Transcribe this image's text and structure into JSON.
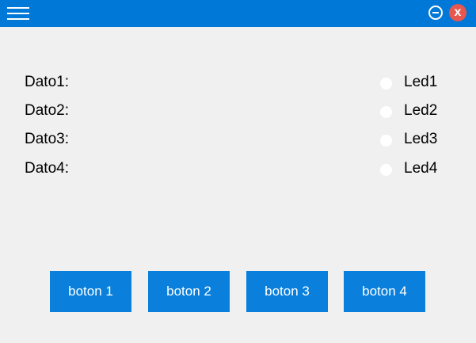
{
  "titlebar": {
    "menu_icon": "hamburger-menu-icon",
    "minimize_icon": "minimize-circle-icon",
    "close_icon": "close-icon",
    "close_glyph": "x",
    "color": "#0078d7",
    "close_color": "#e8574f"
  },
  "datos": [
    {
      "label": "Dato1:"
    },
    {
      "label": "Dato2:"
    },
    {
      "label": "Dato3:"
    },
    {
      "label": "Dato4:"
    }
  ],
  "leds": [
    {
      "label": "Led1"
    },
    {
      "label": "Led2"
    },
    {
      "label": "Led3"
    },
    {
      "label": "Led4"
    }
  ],
  "buttons": [
    {
      "label": "boton 1"
    },
    {
      "label": "boton 2"
    },
    {
      "label": "boton 3"
    },
    {
      "label": "boton 4"
    }
  ],
  "button_color": "#0a80dc"
}
